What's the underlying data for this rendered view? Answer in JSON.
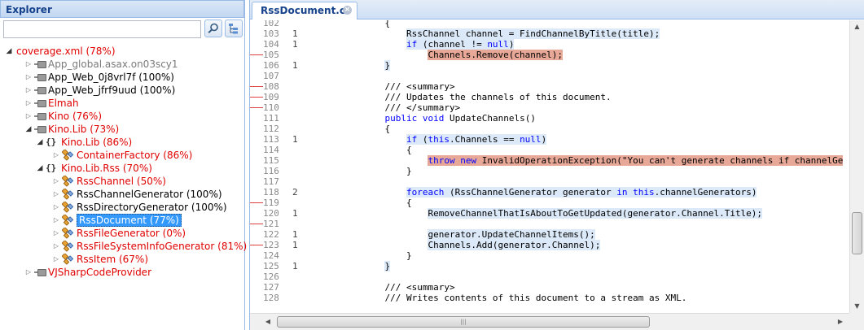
{
  "explorer": {
    "title": "Explorer",
    "search": {
      "value": "",
      "placeholder": ""
    },
    "search_button_icon": "search-icon",
    "tree_button_icon": "tree-view-icon",
    "tree": [
      {
        "label": "coverage.xml (78%)",
        "kind": "root",
        "color": "red",
        "expanded": true
      },
      {
        "label": "App_global.asax.on03scy1",
        "kind": "assembly",
        "color": "gray",
        "expanded": false
      },
      {
        "label": "App_Web_0j8vrl7f (100%)",
        "kind": "assembly",
        "color": "black",
        "expanded": false
      },
      {
        "label": "App_Web_jfrf9uud (100%)",
        "kind": "assembly",
        "color": "black",
        "expanded": false
      },
      {
        "label": "Elmah",
        "kind": "assembly",
        "color": "red",
        "expanded": false
      },
      {
        "label": "Kino (76%)",
        "kind": "assembly",
        "color": "red",
        "expanded": false
      },
      {
        "label": "Kino.Lib (73%)",
        "kind": "assembly",
        "color": "red",
        "expanded": true
      },
      {
        "label": "Kino.Lib (86%)",
        "kind": "namespace",
        "color": "red",
        "expanded": true
      },
      {
        "label": "ContainerFactory (86%)",
        "kind": "class",
        "color": "red",
        "expanded": false
      },
      {
        "label": "Kino.Lib.Rss (70%)",
        "kind": "namespace",
        "color": "red",
        "expanded": true
      },
      {
        "label": "RssChannel (50%)",
        "kind": "class",
        "color": "red",
        "expanded": false
      },
      {
        "label": "RssChannelGenerator (100%)",
        "kind": "class",
        "color": "black",
        "expanded": false
      },
      {
        "label": "RssDirectoryGenerator (100%)",
        "kind": "class",
        "color": "black",
        "expanded": false
      },
      {
        "label": "RssDocument (77%)",
        "kind": "class",
        "color": "red",
        "expanded": false,
        "selected": true
      },
      {
        "label": "RssFileGenerator (0%)",
        "kind": "class",
        "color": "red",
        "expanded": false
      },
      {
        "label": "RssFileSystemInfoGenerator (81%)",
        "kind": "class",
        "color": "red",
        "expanded": false
      },
      {
        "label": "RssItem (67%)",
        "kind": "class",
        "color": "red",
        "expanded": false
      },
      {
        "label": "VJSharpCodeProvider",
        "kind": "assembly",
        "color": "red",
        "expanded": false
      }
    ]
  },
  "editor": {
    "tab_label": "RssDocument.cs",
    "colors": {
      "covered": "#dce9f8",
      "uncovered": "#e7a898",
      "keyword": "#0000ff",
      "gutter_mark": "#e04040"
    },
    "lines": [
      {
        "num": "102",
        "hits": "",
        "mark": false,
        "segments": [
          {
            "t": "            {"
          }
        ]
      },
      {
        "num": "103",
        "hits": "1",
        "mark": false,
        "segments": [
          {
            "t": "                "
          },
          {
            "t": "RssChannel channel = FindChannelByTitle(title);",
            "c": "cov"
          }
        ]
      },
      {
        "num": "104",
        "hits": "1",
        "mark": false,
        "segments": [
          {
            "t": "                "
          },
          {
            "t": "if",
            "c": "cov kw"
          },
          {
            "t": " (channel != ",
            "c": "cov"
          },
          {
            "t": "null",
            "c": "cov kw"
          },
          {
            "t": ")",
            "c": "cov"
          }
        ]
      },
      {
        "num": "105",
        "hits": "",
        "mark": true,
        "segments": [
          {
            "t": "                    "
          },
          {
            "t": "Channels.Remove(channel);",
            "c": "nocov"
          }
        ]
      },
      {
        "num": "106",
        "hits": "1",
        "mark": false,
        "segments": [
          {
            "t": "            "
          },
          {
            "t": "}",
            "c": "cov"
          }
        ]
      },
      {
        "num": "107",
        "hits": "",
        "mark": false,
        "segments": [
          {
            "t": ""
          }
        ]
      },
      {
        "num": "108",
        "hits": "",
        "mark": true,
        "segments": [
          {
            "t": "            /// <summary>"
          }
        ]
      },
      {
        "num": "109",
        "hits": "",
        "mark": true,
        "segments": [
          {
            "t": "            /// Updates the channels of this document."
          }
        ]
      },
      {
        "num": "110",
        "hits": "",
        "mark": true,
        "segments": [
          {
            "t": "            /// </summary>"
          }
        ]
      },
      {
        "num": "111",
        "hits": "",
        "mark": false,
        "segments": [
          {
            "t": "            "
          },
          {
            "t": "public",
            "c": "kw"
          },
          {
            "t": " "
          },
          {
            "t": "void",
            "c": "kw"
          },
          {
            "t": " UpdateChannels()"
          }
        ]
      },
      {
        "num": "112",
        "hits": "",
        "mark": false,
        "segments": [
          {
            "t": "            {"
          }
        ]
      },
      {
        "num": "113",
        "hits": "1",
        "mark": false,
        "segments": [
          {
            "t": "                "
          },
          {
            "t": "if",
            "c": "cov kw"
          },
          {
            "t": " (",
            "c": "cov"
          },
          {
            "t": "this",
            "c": "cov kw"
          },
          {
            "t": ".Channels == ",
            "c": "cov"
          },
          {
            "t": "null",
            "c": "cov kw"
          },
          {
            "t": ")",
            "c": "cov"
          }
        ]
      },
      {
        "num": "114",
        "hits": "",
        "mark": false,
        "segments": [
          {
            "t": "                {"
          }
        ]
      },
      {
        "num": "115",
        "hits": "",
        "mark": false,
        "segments": [
          {
            "t": "                    "
          },
          {
            "t": "throw",
            "c": "nocov kw"
          },
          {
            "t": " ",
            "c": "nocov"
          },
          {
            "t": "new",
            "c": "nocov kw"
          },
          {
            "t": " InvalidOperationException(\"You can't generate channels if channelGe",
            "c": "nocov"
          }
        ]
      },
      {
        "num": "116",
        "hits": "",
        "mark": false,
        "segments": [
          {
            "t": "                }"
          }
        ]
      },
      {
        "num": "117",
        "hits": "",
        "mark": false,
        "segments": [
          {
            "t": ""
          }
        ]
      },
      {
        "num": "118",
        "hits": "2",
        "mark": false,
        "segments": [
          {
            "t": "                "
          },
          {
            "t": "foreach",
            "c": "cov kw"
          },
          {
            "t": " (RssChannelGenerator generator ",
            "c": "cov"
          },
          {
            "t": "in",
            "c": "cov kw"
          },
          {
            "t": " ",
            "c": "cov"
          },
          {
            "t": "this",
            "c": "cov kw"
          },
          {
            "t": ".channelGenerators)",
            "c": "cov"
          }
        ]
      },
      {
        "num": "119",
        "hits": "",
        "mark": true,
        "segments": [
          {
            "t": "                {"
          }
        ]
      },
      {
        "num": "120",
        "hits": "1",
        "mark": false,
        "segments": [
          {
            "t": "                    "
          },
          {
            "t": "RemoveChannelThatIsAboutToGetUpdated(generator.Channel.Title);",
            "c": "cov"
          }
        ]
      },
      {
        "num": "121",
        "hits": "",
        "mark": true,
        "segments": [
          {
            "t": ""
          }
        ]
      },
      {
        "num": "122",
        "hits": "1",
        "mark": false,
        "segments": [
          {
            "t": "                    "
          },
          {
            "t": "generator.UpdateChannelItems();",
            "c": "cov"
          }
        ]
      },
      {
        "num": "123",
        "hits": "1",
        "mark": true,
        "segments": [
          {
            "t": "                    "
          },
          {
            "t": "Channels.Add(generator.Channel);",
            "c": "cov"
          }
        ]
      },
      {
        "num": "124",
        "hits": "",
        "mark": false,
        "segments": [
          {
            "t": "                }"
          }
        ]
      },
      {
        "num": "125",
        "hits": "1",
        "mark": false,
        "segments": [
          {
            "t": "            "
          },
          {
            "t": "}",
            "c": "cov"
          }
        ]
      },
      {
        "num": "126",
        "hits": "",
        "mark": false,
        "segments": [
          {
            "t": ""
          }
        ]
      },
      {
        "num": "127",
        "hits": "",
        "mark": false,
        "segments": [
          {
            "t": "            /// <summary>"
          }
        ]
      },
      {
        "num": "128",
        "hits": "",
        "mark": false,
        "segments": [
          {
            "t": "            /// Writes contents of this document to a stream as XML."
          }
        ]
      }
    ]
  }
}
